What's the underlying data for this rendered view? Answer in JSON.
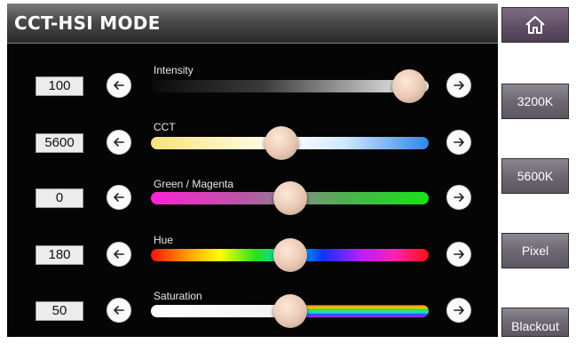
{
  "title": "CCT-HSI MODE",
  "sliders": [
    {
      "label": "Intensity",
      "value": "100",
      "position": 0.93
    },
    {
      "label": "CCT",
      "value": "5600",
      "position": 0.47
    },
    {
      "label": "Green / Magenta",
      "value": "0",
      "position": 0.5
    },
    {
      "label": "Hue",
      "value": "180",
      "position": 0.5
    },
    {
      "label": "Saturation",
      "value": "50",
      "position": 0.5
    }
  ],
  "sidebar": {
    "home_icon": "home-icon",
    "buttons": [
      {
        "label": "3200K"
      },
      {
        "label": "5600K"
      },
      {
        "label": "Pixel"
      },
      {
        "label": "Blackout"
      }
    ]
  },
  "icons": {
    "decrease": "arrow-left-icon",
    "increase": "arrow-right-icon"
  },
  "colors": {
    "background": "#050505",
    "knob": "#e8c7b2",
    "side_button": "#756f7a",
    "home_button": "#6a5870"
  }
}
